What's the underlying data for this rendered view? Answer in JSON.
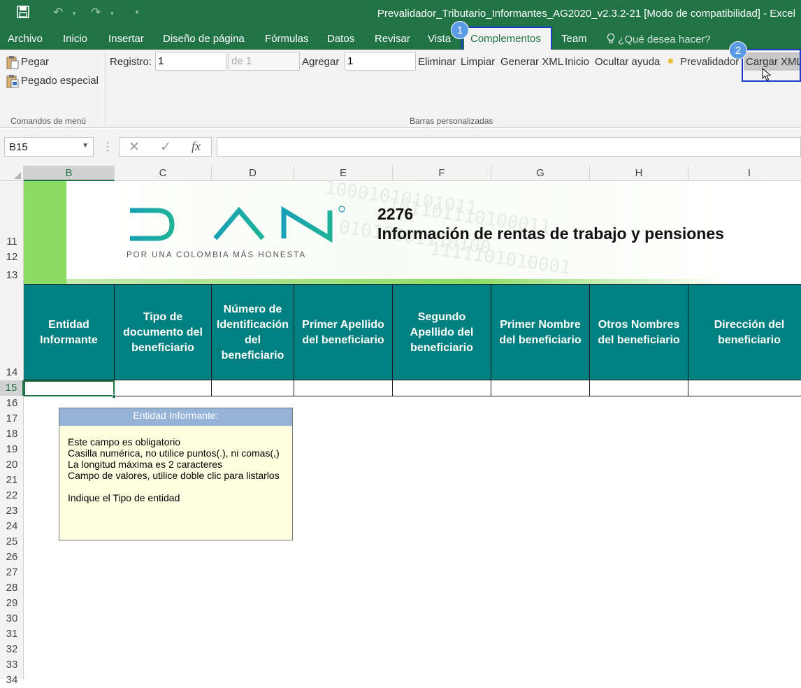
{
  "window": {
    "title": "Prevalidador_Tributario_Informantes_AG2020_v2.3.2-21  [Modo de compatibilidad] - Excel",
    "quick_access": [
      "save-icon",
      "undo-icon",
      "redo-icon",
      "customize-icon"
    ]
  },
  "tabs": [
    {
      "label": "Archivo"
    },
    {
      "label": "Inicio"
    },
    {
      "label": "Insertar"
    },
    {
      "label": "Diseño de página"
    },
    {
      "label": "Fórmulas"
    },
    {
      "label": "Datos"
    },
    {
      "label": "Revisar"
    },
    {
      "label": "Vista"
    },
    {
      "label": "Complementos"
    },
    {
      "label": "Team"
    }
  ],
  "tell_me": "¿Qué desea hacer?",
  "step_badges": [
    "1",
    "2"
  ],
  "ribbon": {
    "paste": "Pegar",
    "paste_special": "Pegado especial",
    "menu_group_label": "Comandos de menú",
    "toolbar_group_label": "Barras personalizadas",
    "registro_label": "Registro:",
    "registro_value": "1",
    "de_value": "de 1",
    "agregar_label": "Agregar",
    "agregar_value": "1",
    "eliminar": "Eliminar",
    "limpiar": "Limpiar",
    "generar_xml": "Generar XML",
    "inicio": "Inicio",
    "ocultar_ayuda": "Ocultar ayuda",
    "prevalidador": "Prevalidador",
    "cargar_xml": "Cargar XML"
  },
  "formula_bar": {
    "name_box": "B15",
    "fx": "fx",
    "content": ""
  },
  "columns": [
    "B",
    "C",
    "D",
    "E",
    "F",
    "G",
    "H",
    "I"
  ],
  "selected_column": "B",
  "rows": [
    "11",
    "12",
    "13",
    "14",
    "15",
    "16",
    "17",
    "18",
    "19",
    "20",
    "21",
    "22",
    "23",
    "24",
    "25",
    "26",
    "27",
    "28",
    "29",
    "30",
    "31",
    "32",
    "33",
    "34"
  ],
  "selected_row": "15",
  "banner": {
    "logo_text": "DIAN",
    "logo_tagline": "POR UNA COLOMBIA MÁS HONESTA",
    "form_number": "2276",
    "form_title": "Información de rentas de trabajo y pensiones",
    "binary_pattern": [
      "10001010101011",
      "101101110100011",
      "01010001110100",
      "1111101010001"
    ]
  },
  "table_headers": [
    "Entidad Informante",
    "Tipo de documento del beneficiario",
    "Número de Identificación del beneficiario",
    "Primer Apellido del beneficiario",
    "Segundo Apellido del beneficiario",
    "Primer Nombre del beneficiario",
    "Otros Nombres del beneficiario",
    "Dirección del beneficiario"
  ],
  "help_box": {
    "title": "Entidad Informante:",
    "lines": [
      "Este campo es obligatorio",
      "Casilla numérica, no utilice puntos(.), ni comas(,)",
      "La longitud máxima es 2 caracteres",
      "Campo de valores, utilice doble clic para listarlos",
      "",
      "Indique el Tipo de entidad"
    ]
  },
  "colors": {
    "excel_green": "#217346",
    "header_teal": "#008080",
    "highlight_blue": "#1c3dcc",
    "badge_blue": "#5b9be6",
    "dian_teal": "#1fa6a8"
  }
}
